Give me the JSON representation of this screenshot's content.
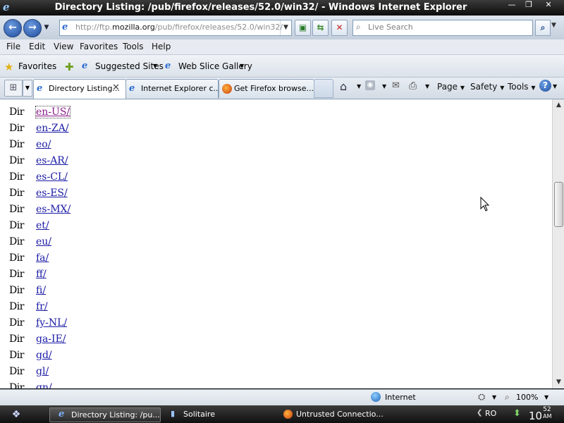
{
  "window": {
    "title": "Directory Listing: /pub/firefox/releases/52.0/win32/ - Windows Internet Explorer",
    "close_glyph": "✕",
    "restore_glyph": "❐",
    "min_glyph": "—"
  },
  "address": {
    "url_prefix": "http://ftp.",
    "url_domain": "mozilla.org",
    "url_path": "/pub/firefox/releases/52.0/win32/",
    "search_placeholder": "Live Search"
  },
  "menu": [
    "File",
    "Edit",
    "View",
    "Favorites",
    "Tools",
    "Help"
  ],
  "favorites_bar": {
    "favorites_label": "Favorites",
    "suggested_sites": "Suggested Sites",
    "web_slice_gallery": "Web Slice Gallery"
  },
  "tabs": [
    {
      "title": "Directory Listing...",
      "active": true
    },
    {
      "title": "Internet Explorer c..."
    },
    {
      "title": "Get Firefox browse..."
    }
  ],
  "commands": {
    "page": "Page",
    "safety": "Safety",
    "tools": "Tools"
  },
  "listing": {
    "type_label": "Dir",
    "entries": [
      {
        "name": "en-US/",
        "visited": true
      },
      {
        "name": "en-ZA/"
      },
      {
        "name": "eo/"
      },
      {
        "name": "es-AR/"
      },
      {
        "name": "es-CL/"
      },
      {
        "name": "es-ES/"
      },
      {
        "name": "es-MX/"
      },
      {
        "name": "et/"
      },
      {
        "name": "eu/"
      },
      {
        "name": "fa/"
      },
      {
        "name": "ff/"
      },
      {
        "name": "fi/"
      },
      {
        "name": "fr/"
      },
      {
        "name": "fy-NL/"
      },
      {
        "name": "ga-IE/"
      },
      {
        "name": "gd/"
      },
      {
        "name": "gl/"
      },
      {
        "name": "gn/"
      }
    ]
  },
  "status": {
    "zone": "Internet",
    "zoom": "100%"
  },
  "taskbar": {
    "tasks": [
      "Directory Listing: /pu...",
      "Solitaire",
      "Untrusted Connectio..."
    ],
    "language": "RO",
    "clock_hour": "10",
    "clock_min": "52",
    "clock_ampm": "AM"
  }
}
